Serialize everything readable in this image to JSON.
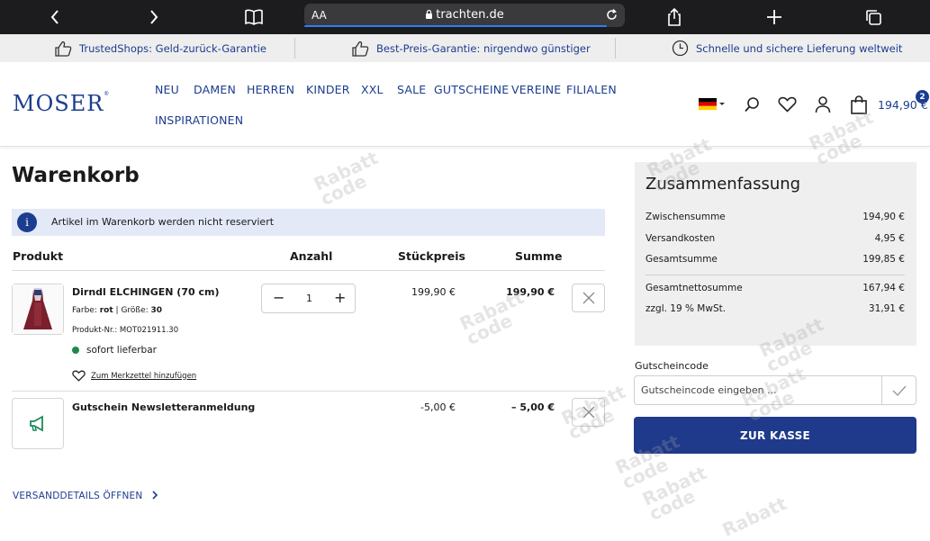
{
  "browser": {
    "aa_label": "AA",
    "url": "trachten.de"
  },
  "trust_bar": [
    {
      "label": "TrustedShops: Geld-zurück-Garantie"
    },
    {
      "label": "Best-Preis-Garantie: nirgendwo günstiger"
    },
    {
      "label": "Schnelle und sichere Lieferung weltweit"
    }
  ],
  "header": {
    "logo": "MOSER",
    "logo_mark": "®",
    "nav": [
      "NEU",
      "DAMEN",
      "HERREN",
      "KINDER",
      "XXL",
      "SALE",
      "GUTSCHEINE",
      "VEREINE",
      "FILIALEN",
      "INSPIRATIONEN"
    ],
    "cart_total": "194,90 €",
    "cart_count": "2"
  },
  "cart": {
    "title": "Warenkorb",
    "notice": "Artikel im Warenkorb werden nicht reserviert",
    "columns": {
      "product": "Produkt",
      "qty": "Anzahl",
      "unit_price": "Stückpreis",
      "sum": "Summe"
    },
    "items": [
      {
        "name": "Dirndl ELCHINGEN (70 cm)",
        "color_label": "Farbe:",
        "color": "rot",
        "size_label": "Größe:",
        "size": "30",
        "sku": "Produkt-Nr.: MOT021911.30",
        "availability": "sofort lieferbar",
        "wishlist": "Zum Merkzettel hinzufügen",
        "qty": "1",
        "unit_price": "199,90 €",
        "sum": "199,90 €"
      },
      {
        "name": "Gutschein Newsletteranmeldung",
        "unit_price": "-5,00 €",
        "sum": "– 5,00 €"
      }
    ],
    "shipping_link": "VERSANDDETAILS ÖFFNEN"
  },
  "summary": {
    "title": "Zusammenfassung",
    "rows": [
      {
        "label": "Zwischensumme",
        "value": "194,90 €"
      },
      {
        "label": "Versandkosten",
        "value": "4,95 €"
      },
      {
        "label": "Gesamtsumme",
        "value": "199,85 €"
      },
      {
        "label": "Gesamtnettosumme",
        "value": "167,94 €"
      },
      {
        "label": "zzgl. 19 % MwSt.",
        "value": "31,91 €"
      }
    ],
    "coupon_label": "Gutscheincode",
    "coupon_placeholder": "Gutscheincode eingeben ...",
    "checkout": "ZUR KASSE"
  },
  "colors": {
    "brand": "#1b3d8f",
    "checkout": "#1f3a8a",
    "notice_bg": "#e3e9f7",
    "available": "#1e8a4a"
  },
  "watermark": {
    "line1": "Rabatt",
    "line2": "code"
  }
}
